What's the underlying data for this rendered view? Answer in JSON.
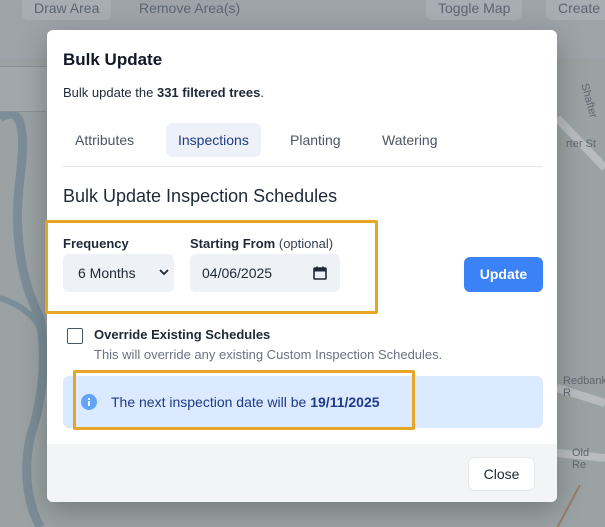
{
  "background": {
    "toolbar_buttons": [
      "Draw Area",
      "Remove Area(s)",
      "Toggle Map",
      "Create"
    ],
    "map_labels": [
      "Shafter",
      "rter St",
      "Redbank R",
      "Old Re"
    ]
  },
  "modal": {
    "title": "Bulk Update",
    "subtitle_prefix": "Bulk update the ",
    "subtitle_bold": "331 filtered trees",
    "subtitle_suffix": ".",
    "tabs": [
      {
        "label": "Attributes",
        "active": false
      },
      {
        "label": "Inspections",
        "active": true
      },
      {
        "label": "Planting",
        "active": false
      },
      {
        "label": "Watering",
        "active": false
      }
    ],
    "section_title": "Bulk Update Inspection Schedules",
    "frequency": {
      "label": "Frequency",
      "value": "6 Months"
    },
    "starting_from": {
      "label": "Starting From",
      "optional": "(optional)",
      "value": "04/06/2025"
    },
    "update_label": "Update",
    "override": {
      "label": "Override Existing Schedules",
      "description": "This will override any existing Custom Inspection Schedules.",
      "checked": false
    },
    "info": {
      "prefix": "The next inspection date will be ",
      "date": "19/11/2025"
    },
    "close_label": "Close"
  },
  "colors": {
    "accent": "#3b82f6",
    "info_bg": "#dbeafe",
    "highlight": "#e6a526"
  }
}
